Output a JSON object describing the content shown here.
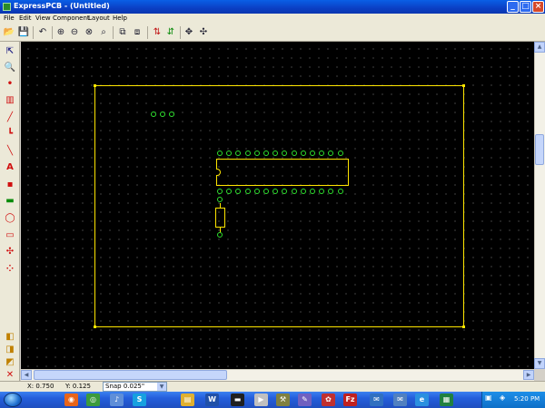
{
  "window": {
    "title": "ExpressPCB - (Untitled)",
    "minimize_label": "_",
    "maximize_label": "□",
    "close_label": "×"
  },
  "menu": [
    "File",
    "Edit",
    "View",
    "Component",
    "Layout",
    "Help"
  ],
  "toolbar": {
    "icons": [
      "open-icon",
      "save-icon",
      "undo-icon",
      "zoom-in-icon",
      "zoom-out-icon",
      "zoom-fit-icon",
      "zoom-all-icon",
      "place-component-icon",
      "component-library-icon",
      "netlist-prev-icon",
      "netlist-next-icon",
      "move-icon",
      "pan-icon"
    ],
    "glyphs": [
      "📂",
      "💾",
      "↶",
      "⊕",
      "⊖",
      "⊗",
      "⌕",
      "⧉",
      "⧈",
      "⇅",
      "⇵",
      "✥",
      "✣"
    ]
  },
  "palette": {
    "icons": [
      "select-icon",
      "zoom-icon",
      "pad-icon",
      "component-icon",
      "trace-icon",
      "corner-icon",
      "line-icon",
      "text-icon",
      "fill-icon",
      "plane-icon",
      "circle-icon",
      "rectangle-icon",
      "ratsnest-icon",
      "multi-pad-icon",
      "layer-top-icon",
      "layer-bottom-icon",
      "layer-silk-icon",
      "layer-all-icon"
    ],
    "glyphs": [
      "⇱",
      "🔍",
      "•",
      "▥",
      "╱",
      "┗",
      "╲",
      "A",
      "▪",
      "▬",
      "◯",
      "▭",
      "✣",
      "⁘",
      "◧",
      "◨",
      "◩",
      "✕"
    ],
    "colors": [
      "#2a2a88",
      "#2a2a88",
      "#d01010",
      "#d01010",
      "#d01010",
      "#d01010",
      "#d01010",
      "#d01010",
      "#d01010",
      "#0a8a0a",
      "#d01010",
      "#d01010",
      "#d01010",
      "#d01010",
      "#c08000",
      "#c08000",
      "#c08000",
      "#d01010"
    ]
  },
  "colors": {
    "board_outline": "#ffe600",
    "pads": "#2ee02e",
    "canvas": "#000000"
  },
  "status": {
    "x_readout": "X: 0.750",
    "y_readout": "Y: 0.125",
    "snap": "Snap  0.025\""
  },
  "taskbar": {
    "icons": [
      "firefox-icon",
      "chrome-icon",
      "itunes-icon",
      "skype-icon",
      "folder-icon",
      "word-icon",
      "cmd-icon",
      "media-icon",
      "tools-icon",
      "chat-icon",
      "paint-icon",
      "filezilla-icon",
      "messenger-icon",
      "mail-icon",
      "explorer-icon",
      "expresspcb-icon"
    ],
    "glyphs": [
      "◉",
      "◎",
      "♪",
      "S",
      "▤",
      "W",
      "▬",
      "▶",
      "⚒",
      "✎",
      "✿",
      "Fz",
      "✉",
      "✉",
      "e",
      "▦"
    ],
    "colors": [
      "#e8641a",
      "#3c9b3c",
      "#5e8ed8",
      "#16a0e0",
      "#e0b030",
      "#2050a8",
      "#202020",
      "#c0c0c0",
      "#808040",
      "#7060c0",
      "#c03030",
      "#c02020",
      "#3070c0",
      "#5080c0",
      "#2a90e0",
      "#208040"
    ],
    "tray_icons": [
      "network-icon",
      "volume-icon"
    ],
    "tray_glyphs": [
      "▣",
      "◈"
    ],
    "clock": "5:20 PM"
  }
}
